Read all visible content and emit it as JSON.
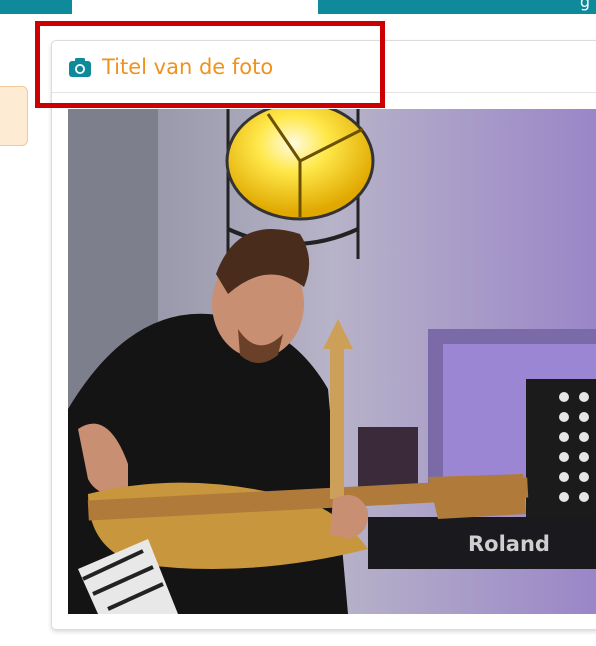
{
  "card": {
    "title": "Titel van de foto",
    "icon": "camera-icon"
  },
  "photo": {
    "logo_text": "Roland"
  },
  "colors": {
    "brand_teal": "#0e8a9a",
    "title_orange": "#f0921e",
    "highlight_red": "#cc0000"
  }
}
